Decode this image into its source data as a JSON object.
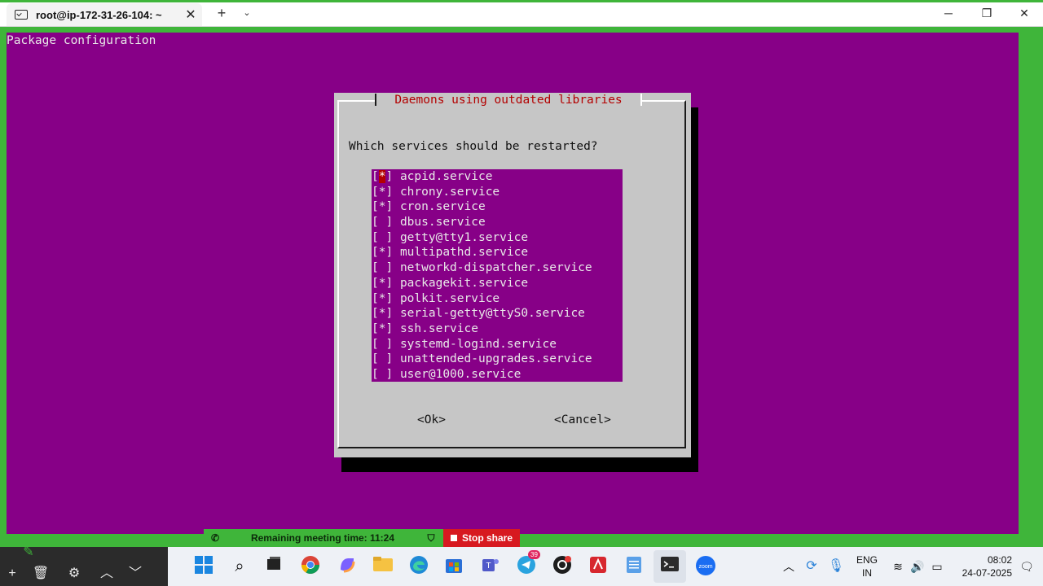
{
  "window": {
    "tab_title": "root@ip-172-31-26-104: ~",
    "tab_close": "✕",
    "new_tab": "+",
    "tab_menu": "⌄",
    "minimize": "─",
    "maximize": "❐",
    "close": "✕"
  },
  "terminal": {
    "header": "Package configuration",
    "dialog": {
      "title": "Daemons using outdated libraries",
      "question": "Which services should be restarted?",
      "items": [
        {
          "checked": "*",
          "label": "acpid.service"
        },
        {
          "checked": "*",
          "label": "chrony.service"
        },
        {
          "checked": "*",
          "label": "cron.service"
        },
        {
          "checked": " ",
          "label": "dbus.service"
        },
        {
          "checked": " ",
          "label": "getty@tty1.service"
        },
        {
          "checked": "*",
          "label": "multipathd.service"
        },
        {
          "checked": " ",
          "label": "networkd-dispatcher.service"
        },
        {
          "checked": "*",
          "label": "packagekit.service"
        },
        {
          "checked": "*",
          "label": "polkit.service"
        },
        {
          "checked": "*",
          "label": "serial-getty@ttyS0.service"
        },
        {
          "checked": "*",
          "label": "ssh.service"
        },
        {
          "checked": " ",
          "label": "systemd-logind.service"
        },
        {
          "checked": " ",
          "label": "unattended-upgrades.service"
        },
        {
          "checked": " ",
          "label": "user@1000.service"
        }
      ],
      "ok": "<Ok>",
      "cancel": "<Cancel>"
    }
  },
  "meeting": {
    "remaining": "Remaining meeting time: 11:24",
    "stop_share": "Stop share"
  },
  "taskbar": {
    "lang_line1": "ENG",
    "lang_line2": "IN",
    "time": "08:02",
    "date": "24-07-2025",
    "telegram_badge": "39",
    "zoom_label": "zoom"
  },
  "colors": {
    "terminal_bg": "#870087",
    "dialog_bg": "#c6c6c6",
    "title_red": "#b30000",
    "meeting_green": "#3fb53a",
    "stop_red": "#d71920"
  }
}
